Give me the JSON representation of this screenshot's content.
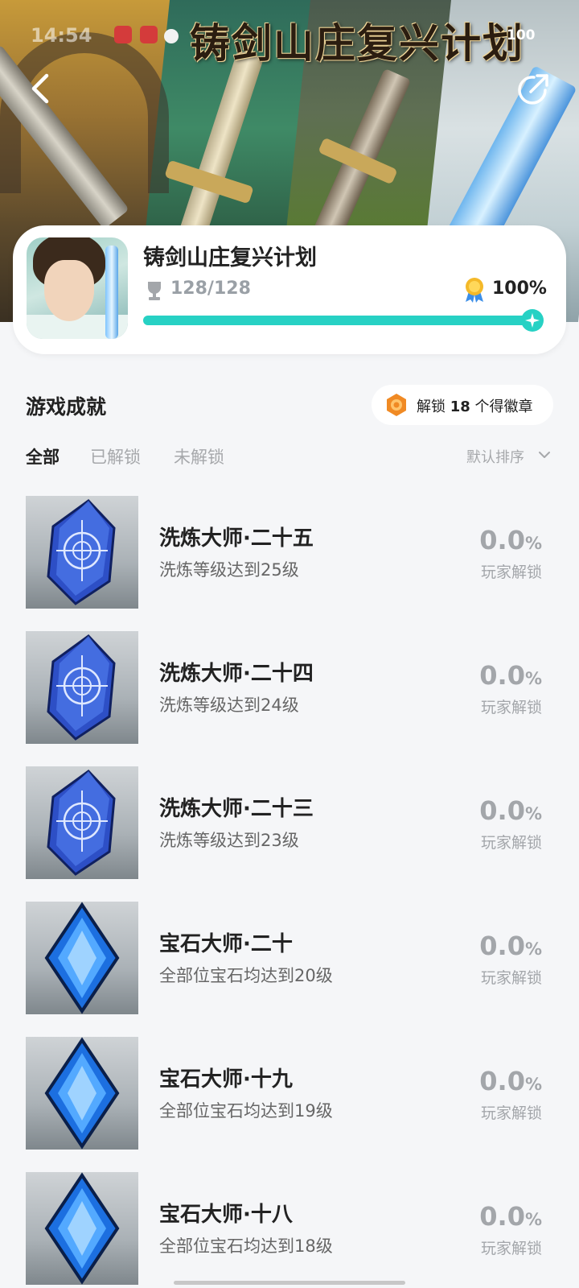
{
  "status_bar": {
    "time": "14:54",
    "battery": "100"
  },
  "banner": {
    "title": "铸剑山庄复兴计划"
  },
  "game": {
    "name": "铸剑山庄复兴计划",
    "trophies": "128/128",
    "completion": "100%",
    "progress_fraction": 1.0
  },
  "section": {
    "title": "游戏成就",
    "badge": {
      "prefix": "解锁",
      "count": "18",
      "suffix": "个得徽章"
    }
  },
  "tabs": [
    {
      "label": "全部",
      "active": true
    },
    {
      "label": "已解锁",
      "active": false
    },
    {
      "label": "未解锁",
      "active": false
    }
  ],
  "sort_label": "默认排序",
  "achievements": [
    {
      "name": "洗炼大师·二十五",
      "desc": "洗炼等级达到25级",
      "rate": "0.0",
      "unit": "%",
      "rate_label": "玩家解锁",
      "icon": "rune-crystal-icon"
    },
    {
      "name": "洗炼大师·二十四",
      "desc": "洗炼等级达到24级",
      "rate": "0.0",
      "unit": "%",
      "rate_label": "玩家解锁",
      "icon": "rune-crystal-icon"
    },
    {
      "name": "洗炼大师·二十三",
      "desc": "洗炼等级达到23级",
      "rate": "0.0",
      "unit": "%",
      "rate_label": "玩家解锁",
      "icon": "rune-crystal-icon"
    },
    {
      "name": "宝石大师·二十",
      "desc": "全部位宝石均达到20级",
      "rate": "0.0",
      "unit": "%",
      "rate_label": "玩家解锁",
      "icon": "blue-gem-icon"
    },
    {
      "name": "宝石大师·十九",
      "desc": "全部位宝石均达到19级",
      "rate": "0.0",
      "unit": "%",
      "rate_label": "玩家解锁",
      "icon": "blue-gem-icon"
    },
    {
      "name": "宝石大师·十八",
      "desc": "全部位宝石均达到18级",
      "rate": "0.0",
      "unit": "%",
      "rate_label": "玩家解锁",
      "icon": "blue-gem-icon"
    }
  ],
  "colors": {
    "accent": "#27d1c4",
    "muted": "#a3a6aa",
    "badge": "#f08a24"
  }
}
